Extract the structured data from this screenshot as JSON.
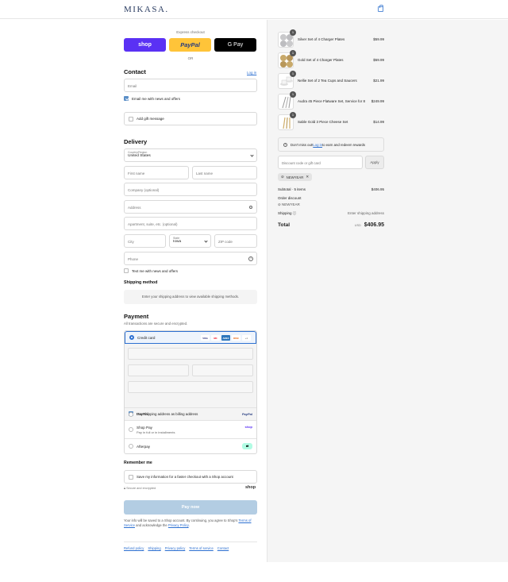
{
  "brand": {
    "logo": "MIKASA."
  },
  "express": {
    "label": "Express checkout",
    "shop": "shop",
    "paypal": "PayPal",
    "gpay": "G Pay",
    "or": "OR"
  },
  "contact": {
    "title": "Contact",
    "login_link": "Log in",
    "email_placeholder": "Email",
    "email_news": "Email me with news and offers",
    "gift_message": "Add gift message"
  },
  "delivery": {
    "title": "Delivery",
    "country_label": "Country/Region",
    "country_value": "United States",
    "first_name": "First name",
    "last_name": "Last name",
    "company": "Company (optional)",
    "address": "Address",
    "apartment": "Apartment, suite, etc. (optional)",
    "city": "City",
    "state_label": "State",
    "state_value": "Iowa",
    "zip": "ZIP code",
    "phone": "Phone",
    "text_news": "Text me with news and offers"
  },
  "shipping": {
    "title": "Shipping method",
    "note": "Enter your shipping address to view available shipping methods."
  },
  "payment": {
    "title": "Payment",
    "subtitle": "All transactions are secure and encrypted.",
    "credit_card": "Credit card",
    "cards": [
      "VISA",
      "MC",
      "AMEX",
      "DISC",
      "+1"
    ],
    "use_shipping": "Use shipping address as billing address",
    "paypal": "PayPal",
    "paypal_logo": "PayPal",
    "shop_pay": "Shop Pay",
    "shop_pay_sub": "Pay in full or in installments",
    "shop_pay_logo": "shop",
    "afterpay": "Afterpay"
  },
  "remember": {
    "title": "Remember me",
    "save_info": "Save my information for a faster checkout with a Shop account",
    "secure": "Secure and encrypted",
    "shop_logo": "shop"
  },
  "pay_now": "Pay now",
  "legal": {
    "text1": "Your info will be saved to a Shop account. By continuing, you agree to Shop's ",
    "tos": "Terms of Service",
    "text2": " and acknowledge the ",
    "privacy": "Privacy Policy",
    "text3": "."
  },
  "footer": [
    "Refund policy",
    "Shipping",
    "Privacy policy",
    "Terms of service",
    "Contact"
  ],
  "order": {
    "items": [
      {
        "name": "Silver Set of 4 Charger Plates",
        "price": "$59.99",
        "qty": "1",
        "color": "#c9c9cb"
      },
      {
        "name": "Gold Set of 4 Charger Plates",
        "price": "$59.99",
        "qty": "1",
        "color": "#c8a96a"
      },
      {
        "name": "Nellie Set of 2 Tea Cups and Saucers",
        "price": "$21.99",
        "qty": "1",
        "color": "#f0f0f0"
      },
      {
        "name": "Audra 45 Piece Flatware Set, Service for 8",
        "price": "$249.99",
        "qty": "1",
        "color": "#a9a9a9"
      },
      {
        "name": "Sable Gold 3 Piece Cheese Set",
        "price": "$14.99",
        "qty": "1",
        "color": "#cfae6a"
      }
    ],
    "rewards_text": "Don't miss out! ",
    "rewards_link": "Log in",
    "rewards_rest": " to earn and redeem rewards",
    "discount_placeholder": "Discount code or gift card",
    "apply": "Apply",
    "code": "NEWYEAR",
    "subtotal_label": "Subtotal · 5 items",
    "subtotal_value": "$406.95",
    "order_discount": "Order discount",
    "discount_code": "NEWYEAR",
    "shipping_label": "Shipping",
    "shipping_value": "Enter shipping address",
    "total_label": "Total",
    "currency": "USD",
    "total_value": "$406.95"
  }
}
